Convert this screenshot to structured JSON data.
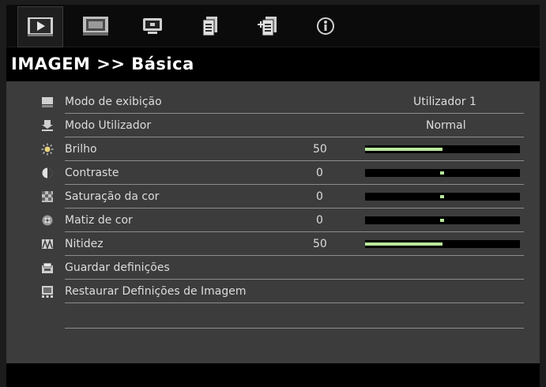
{
  "header": {
    "title": "IMAGEM >> Básica"
  },
  "tabs": [
    {
      "icon": "image-play-icon",
      "active": true
    },
    {
      "icon": "display-film-icon",
      "active": false
    },
    {
      "icon": "screen-settings-icon",
      "active": false
    },
    {
      "icon": "document-icon",
      "active": false
    },
    {
      "icon": "document-plus-icon",
      "active": false
    },
    {
      "icon": "info-icon",
      "active": false
    }
  ],
  "menu": {
    "items": [
      {
        "label": "Modo de exibição",
        "value": "Utilizador 1",
        "icon": "display-mode-icon"
      },
      {
        "label": "Modo Utilizador",
        "value": "Normal",
        "icon": "user-mode-icon"
      },
      {
        "label": "Brilho",
        "value": "50",
        "level": 0.5,
        "icon": "brightness-sun-icon"
      },
      {
        "label": "Contraste",
        "value": "0",
        "level": 0.5,
        "icon": "contrast-icon"
      },
      {
        "label": "Saturação da cor",
        "value": "0",
        "level": 0.5,
        "icon": "saturation-icon"
      },
      {
        "label": "Matiz de cor",
        "value": "0",
        "level": 0.5,
        "icon": "hue-icon"
      },
      {
        "label": "Nitidez",
        "value": "50",
        "level": 0.5,
        "icon": "sharpness-icon"
      },
      {
        "label": "Guardar definições",
        "value": "",
        "icon": "save-settings-icon"
      },
      {
        "label": "Restaurar Definições de Imagem",
        "value": "",
        "icon": "reset-image-icon"
      }
    ]
  },
  "colors": {
    "accent": "#b9e89b",
    "menu_bg": "#3c3c3c",
    "text": "#dcdcdc"
  }
}
